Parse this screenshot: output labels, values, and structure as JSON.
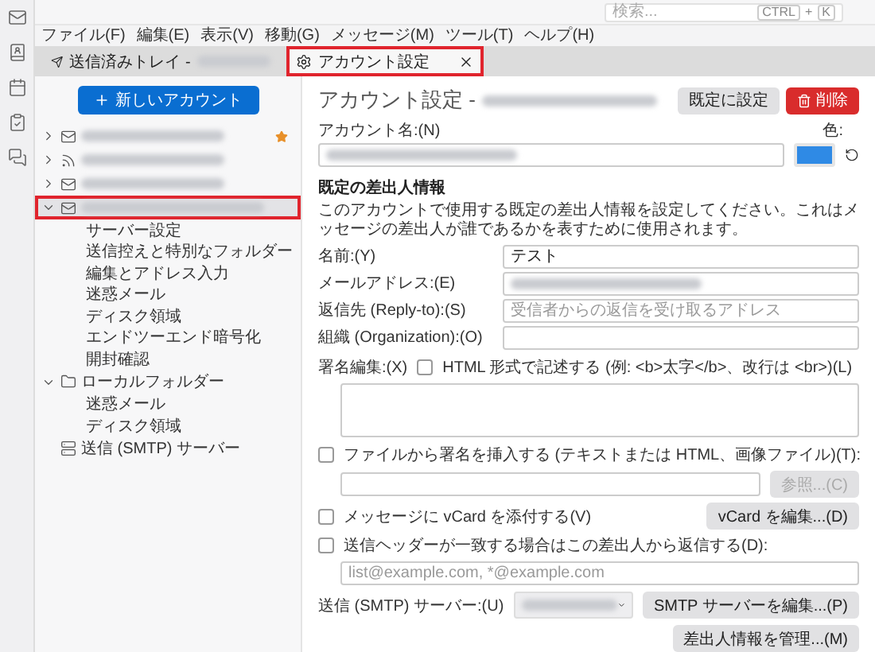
{
  "search": {
    "placeholder": "検索...",
    "keys": [
      "CTRL",
      "K"
    ],
    "joiner": "+"
  },
  "menu": [
    "ファイル(F)",
    "編集(E)",
    "表示(V)",
    "移動(G)",
    "メッセージ(M)",
    "ツール(T)",
    "ヘルプ(H)"
  ],
  "tabs": [
    {
      "label": "送信済みトレイ -",
      "kind": "sent",
      "selected": false,
      "closable": false,
      "highlighted": false
    },
    {
      "label": "アカウント設定",
      "kind": "settings",
      "selected": true,
      "closable": true,
      "highlighted": true
    }
  ],
  "sidebar": {
    "new_account": "新しいアカウント",
    "accounts": [
      {
        "kind": "mail",
        "expanded": false,
        "selected": false,
        "default": true,
        "highlighted": false
      },
      {
        "kind": "feed",
        "expanded": false,
        "selected": false,
        "default": false,
        "highlighted": false
      },
      {
        "kind": "mail",
        "expanded": false,
        "selected": false,
        "default": false,
        "highlighted": false
      },
      {
        "kind": "mail",
        "expanded": true,
        "selected": true,
        "default": false,
        "highlighted": true,
        "children": [
          "サーバー設定",
          "送信控えと特別なフォルダー",
          "編集とアドレス入力",
          "迷惑メール",
          "ディスク領域",
          "エンドツーエンド暗号化",
          "開封確認"
        ]
      }
    ],
    "local_folders": {
      "label": "ローカルフォルダー",
      "expanded": true,
      "children": [
        "迷惑メール",
        "ディスク領域"
      ]
    },
    "smtp": "送信 (SMTP) サーバー"
  },
  "account": {
    "title": "アカウント設定 -",
    "set_default": "既定に設定",
    "delete": "削除",
    "name_label": "アカウント名:(N)",
    "color_label": "色:",
    "color": "#2f8ae5"
  },
  "identity": {
    "heading": "既定の差出人情報",
    "description": "このアカウントで使用する既定の差出人情報を設定してください。これはメッセージの差出人が誰であるかを表すために使用されます。",
    "fields": [
      {
        "label": "名前:(Y)",
        "value": "テスト"
      },
      {
        "label": "メールアドレス:(E)",
        "blurred": true
      },
      {
        "label": "返信先 (Reply-to):(S)",
        "placeholder": "受信者からの返信を受け取るアドレス"
      },
      {
        "label": "組織 (Organization):(O)"
      }
    ],
    "signature_label": "署名編集:(X)",
    "html": {
      "label": "HTML 形式で記述する (例: <b>太字</b>、改行は <br>)(L)",
      "checked": false
    },
    "sig_file": {
      "label": "ファイルから署名を挿入する (テキストまたは HTML、画像ファイル)(T):",
      "checked": false,
      "browse": "参照...(C)",
      "browse_disabled": true
    },
    "vcard": {
      "label": "メッセージに vCard を添付する(V)",
      "checked": false,
      "button": "vCard を編集...(D)"
    },
    "reply_from": {
      "label": "送信ヘッダーが一致する場合はこの差出人から返信する(D):",
      "checked": false,
      "placeholder": "list@example.com, *@example.com"
    },
    "smtp": {
      "label": "送信 (SMTP) サーバー:(U)",
      "button": "SMTP サーバーを編集...(P)"
    },
    "manage": "差出人情報を管理...(M)"
  }
}
